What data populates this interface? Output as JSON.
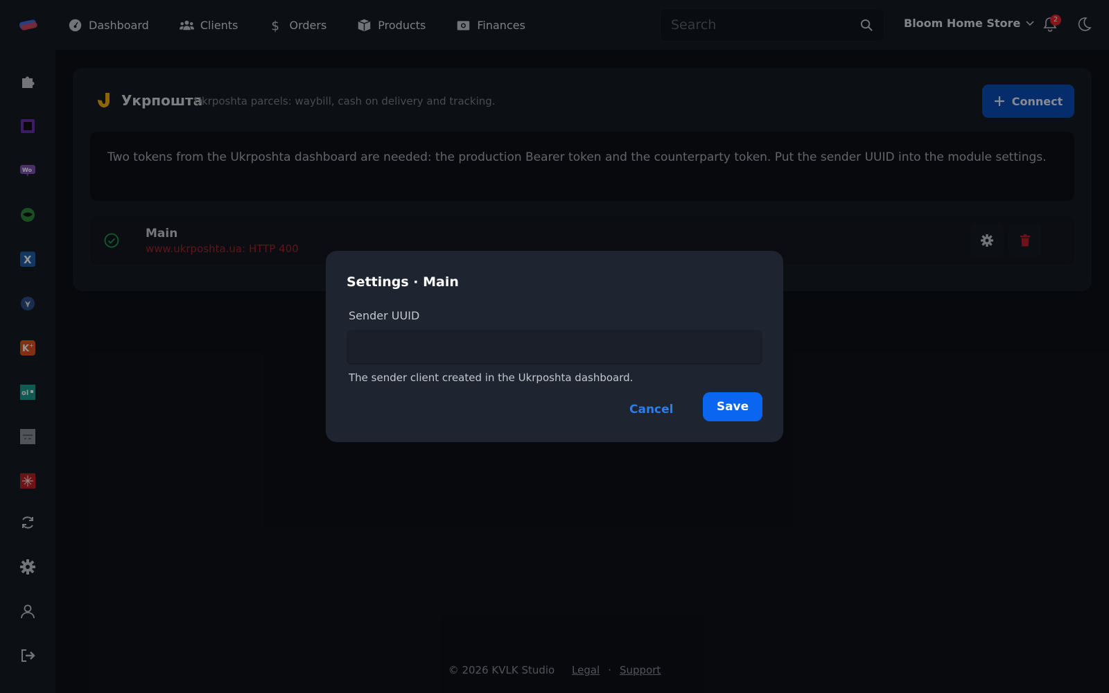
{
  "nav": {
    "items": [
      {
        "label": "Dashboard",
        "icon": "dashboard-gauge-icon"
      },
      {
        "label": "Clients",
        "icon": "users-icon"
      },
      {
        "label": "Orders",
        "icon": "dollar-icon"
      },
      {
        "label": "Products",
        "icon": "box-icon"
      },
      {
        "label": "Finances",
        "icon": "money-icon"
      }
    ]
  },
  "search": {
    "placeholder": "Search",
    "value": ""
  },
  "store": {
    "name": "Bloom Home Store"
  },
  "notifications": {
    "count": "2"
  },
  "sidebar": {
    "icons": [
      "puzzle-icon",
      "square-app-icon",
      "woo-icon",
      "green-app-icon",
      "x-app-icon",
      "shield-app-icon",
      "k-app-icon",
      "ol-app-icon",
      "grey-app-icon",
      "red-app-icon",
      "sync-icon",
      "gear-icon",
      "user-icon",
      "logout-icon"
    ]
  },
  "integration": {
    "title": "Укрпошта",
    "subtitle": "Ukrposhta parcels: waybill, cash on delivery and tracking.",
    "connect_label": "Connect",
    "info": "Two tokens from the Ukrposhta dashboard are needed: the production Bearer token and the counterparty token. Put the sender UUID into the module settings."
  },
  "connection": {
    "name": "Main",
    "error": "www.ukrposhta.ua: HTTP 400"
  },
  "modal": {
    "title": "Settings · Main",
    "field_label": "Sender UUID",
    "field_value": "",
    "field_help": "The sender client created in the Ukrposhta dashboard.",
    "cancel_label": "Cancel",
    "save_label": "Save"
  },
  "footer": {
    "copyright": "© 2026 KVLK Studio",
    "legal": "Legal",
    "separator": "·",
    "support": "Support"
  },
  "colors": {
    "accent": "#0a66f0",
    "error": "#a3262a",
    "success": "#1f9d55",
    "danger": "#c0202a"
  }
}
